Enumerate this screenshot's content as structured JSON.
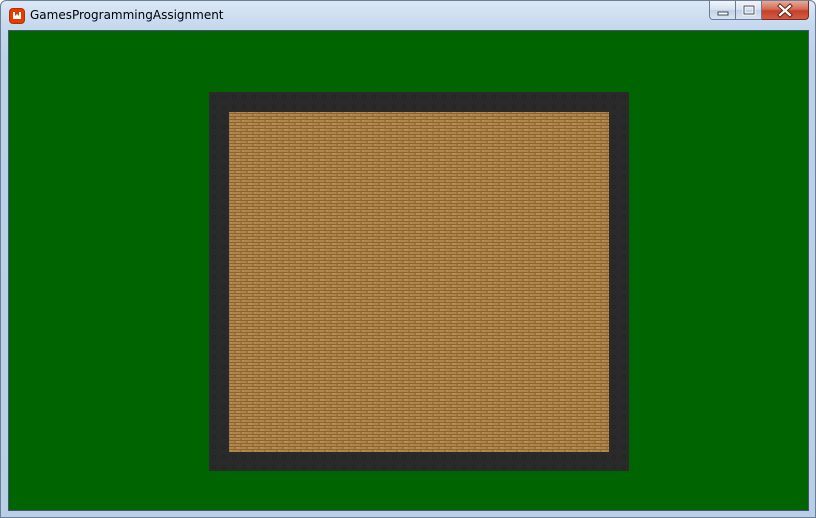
{
  "window": {
    "title": "GamesProgrammingAssignment",
    "icon": "monogame-logo-icon"
  },
  "title_bar_buttons": {
    "minimize_icon": "minimize-icon",
    "maximize_icon": "maximize-icon",
    "close_icon": "close-icon"
  },
  "game_view": {
    "background_color": "#006400",
    "wall_color": "#2a2a2a",
    "floor_color": "#b08548"
  }
}
